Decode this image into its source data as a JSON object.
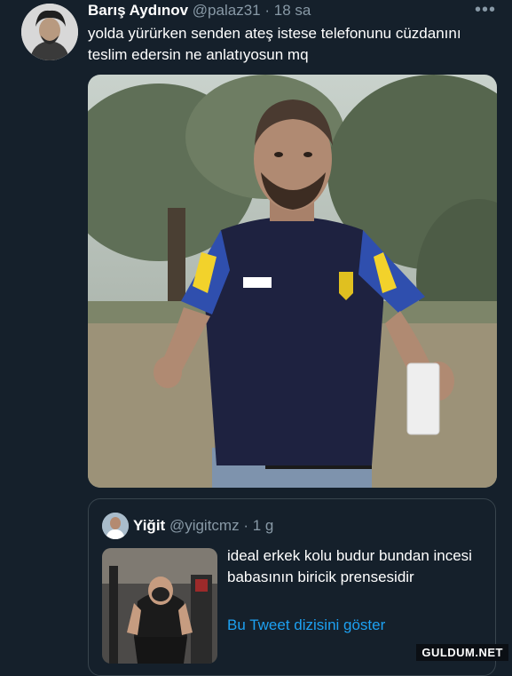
{
  "tweet": {
    "display_name": "Barış Aydınov",
    "handle": "@palaz31",
    "separator": "·",
    "time": "18 sa",
    "more_label": "•••",
    "text": "yolda yürürken senden ateş istese telefonunu cüzdanını teslim edersin ne anlatıyosun mq"
  },
  "quoted": {
    "display_name": "Yiğit",
    "handle": "@yigitcmz",
    "separator": "·",
    "time": "1 g",
    "text": "ideal erkek kolu budur bundan incesi babasının biricik prensesidir",
    "thread_link": "Bu Tweet dizisini göster"
  },
  "watermark": "GULDUM.NET",
  "colors": {
    "background": "#15202b",
    "muted": "#8899a6",
    "link": "#1da1f2",
    "border": "#38444d"
  },
  "icons": [
    "more-icon"
  ]
}
